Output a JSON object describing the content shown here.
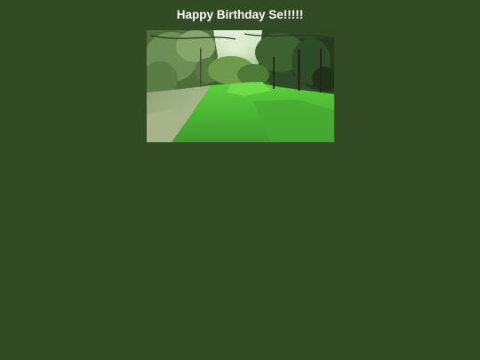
{
  "page": {
    "background_color": "#334b24",
    "headline": "Happy Birthday Se!!!!!",
    "headline_color": "#ffffff"
  },
  "photo": {
    "subject": "forest-clearing-photo"
  }
}
